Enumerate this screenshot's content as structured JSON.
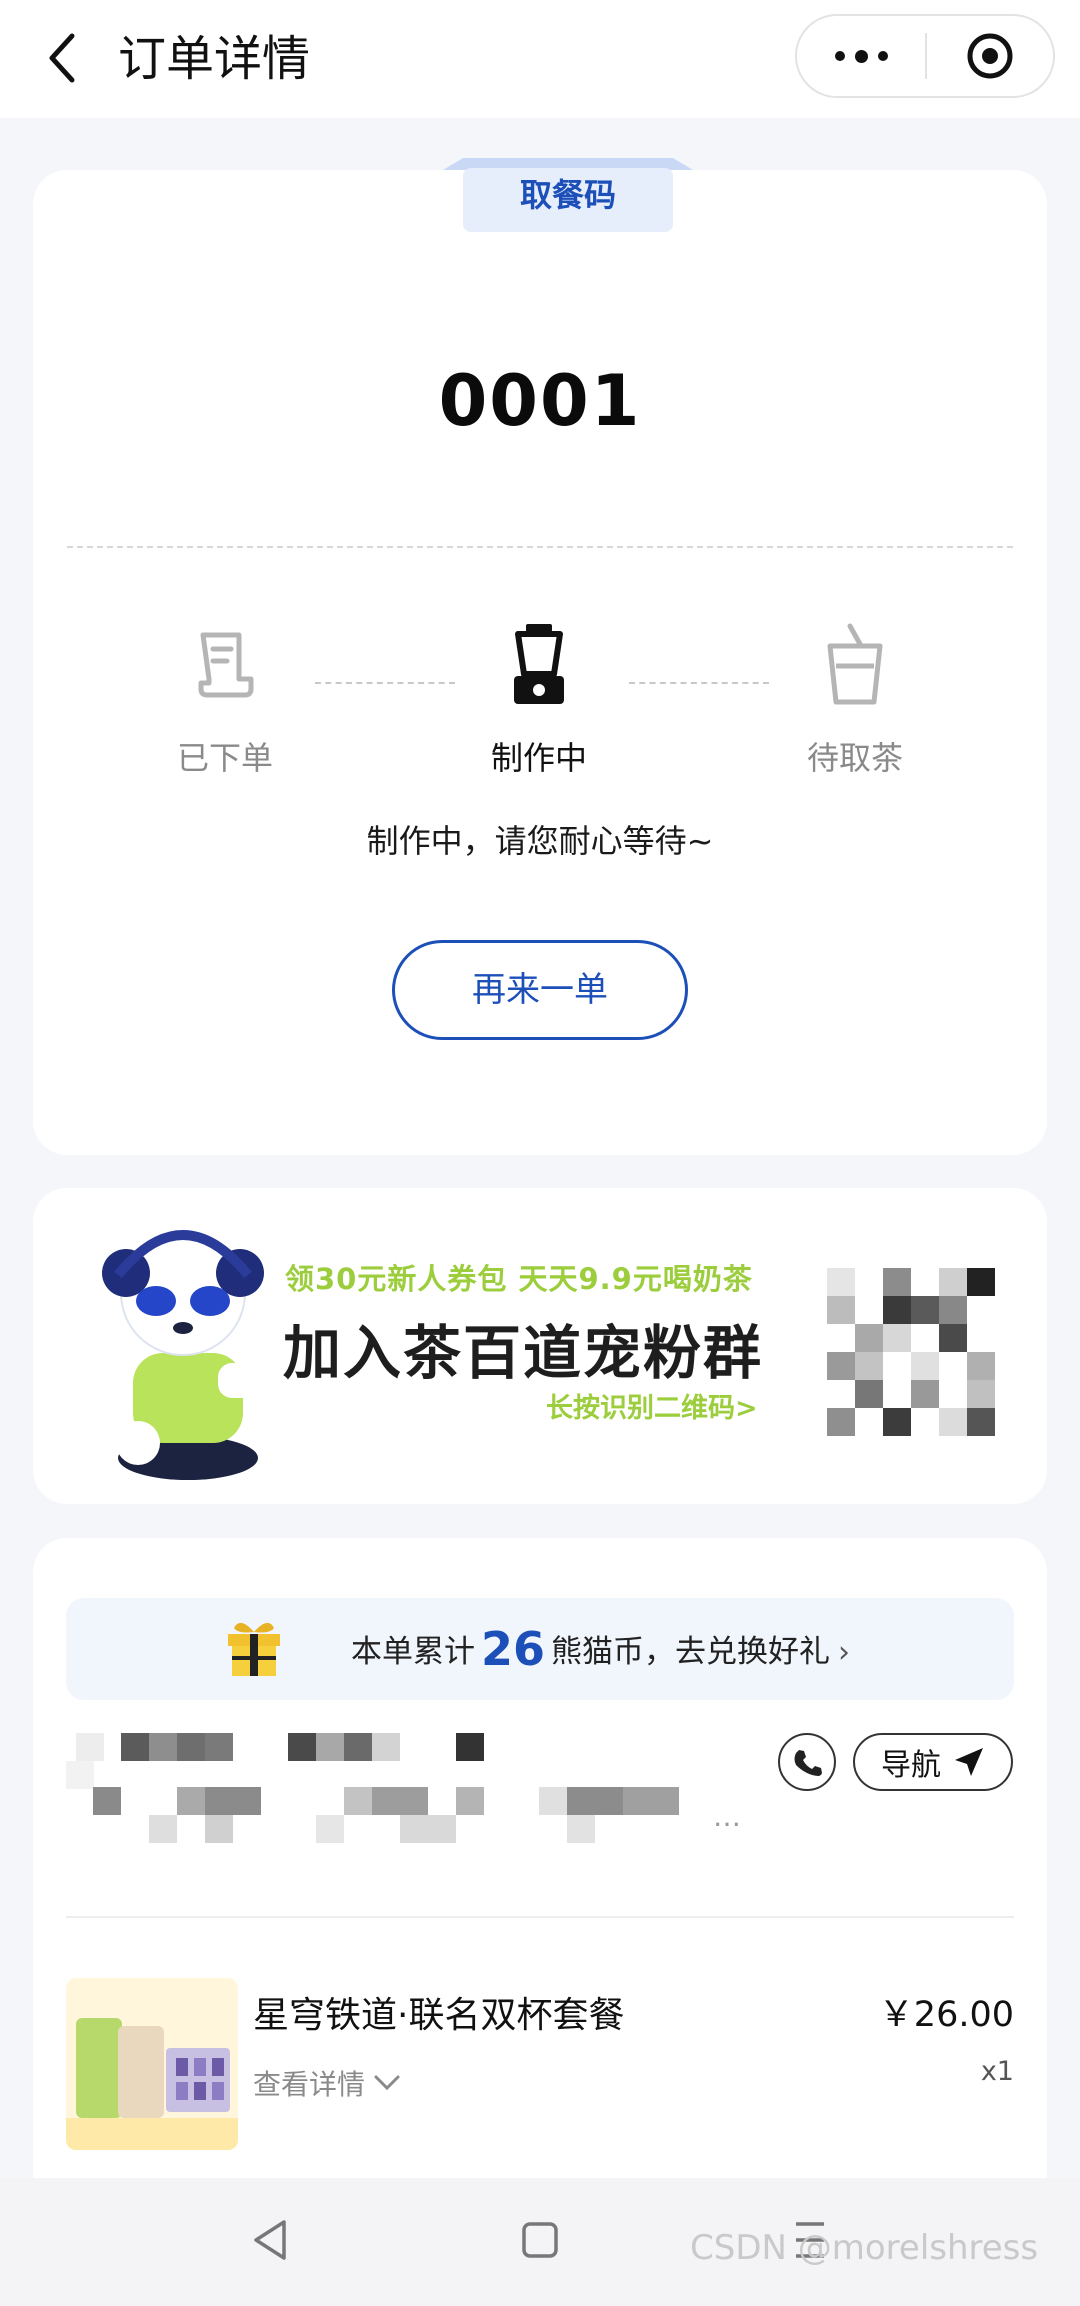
{
  "header": {
    "title": "订单详情"
  },
  "pickup": {
    "tab_label": "取餐码",
    "code": "0001",
    "steps": [
      {
        "label": "已下单"
      },
      {
        "label": "制作中"
      },
      {
        "label": "待取茶"
      }
    ],
    "status_text": "制作中，请您耐心等待~",
    "reorder_label": "再来一单"
  },
  "banner": {
    "line1": "领30元新人券包  天天9.9元喝奶茶",
    "line2": "加入茶百道宠粉群",
    "line3": "长按识别二维码>"
  },
  "order": {
    "coins_prefix": "本单累计",
    "coins_value": "26",
    "coins_suffix": "熊猫币，去兑换好礼",
    "nav_label": "导航",
    "store_ellipsis": "…",
    "product": {
      "name": "星穹铁道·联名双杯套餐",
      "detail_label": "查看详情",
      "price": "￥26.00",
      "qty": "x1"
    }
  },
  "watermark": "CSDN @morelshress",
  "colors": {
    "accent": "#1c4fb8",
    "banner_green": "#9ccd3c",
    "background": "#f4f6fa"
  }
}
